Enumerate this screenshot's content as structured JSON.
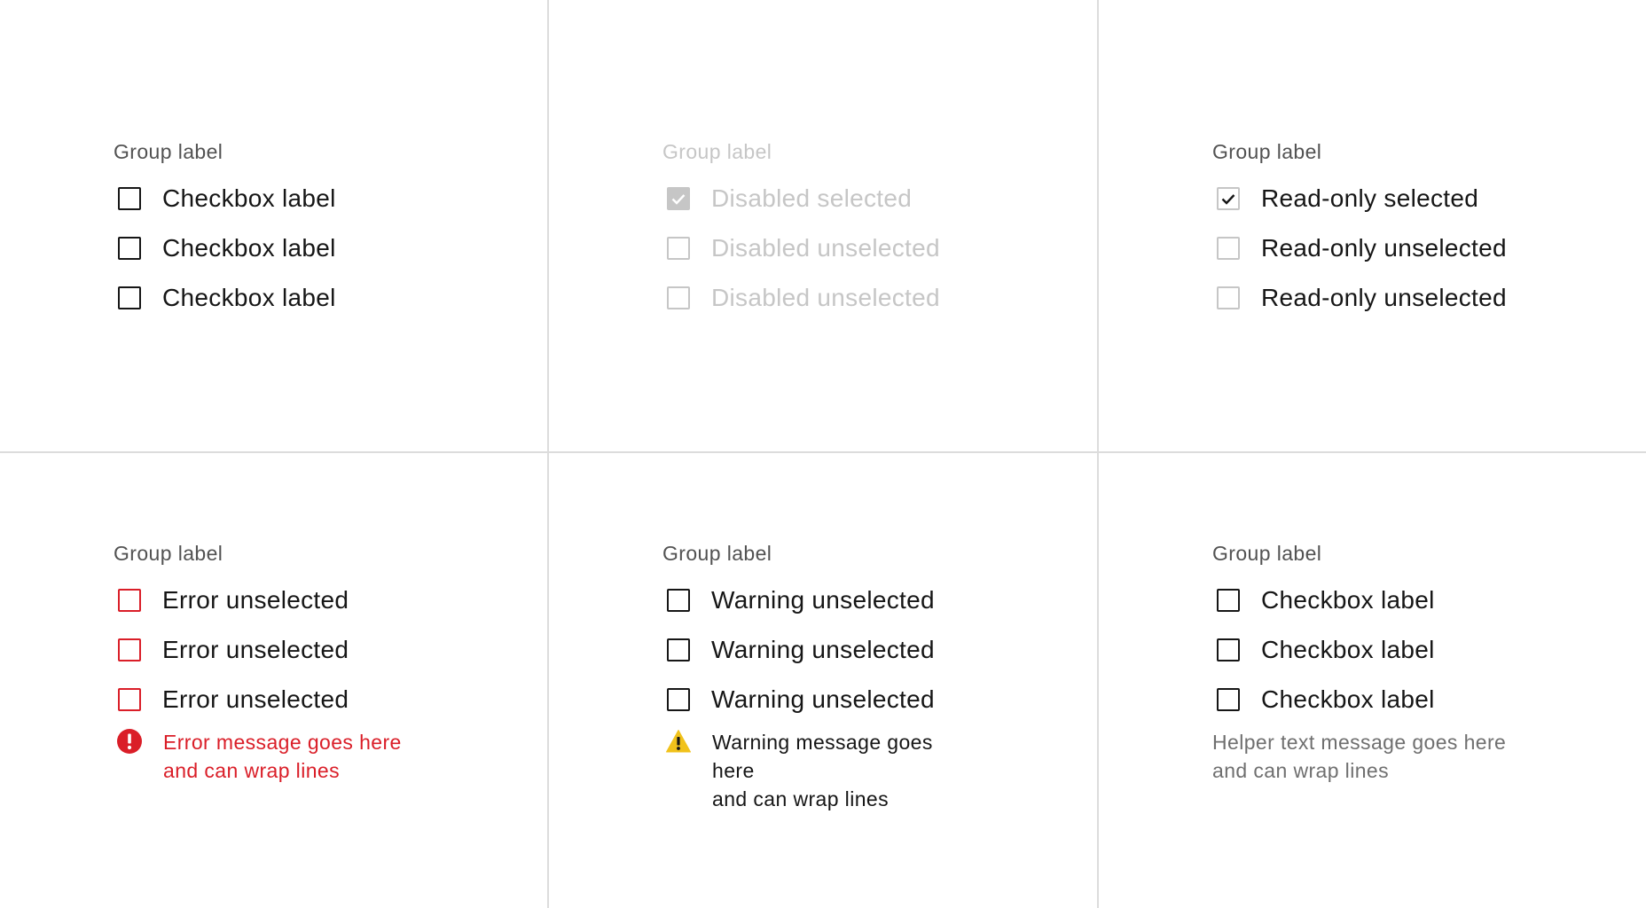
{
  "colors": {
    "text": "#161616",
    "label": "#525252",
    "disabled": "#c6c6c6",
    "error": "#da1e28",
    "warning": "#f1c21b",
    "helper": "#6f6f6f",
    "divider": "#dcdcdc"
  },
  "groups": [
    {
      "state": "default",
      "label": "Group label",
      "options": [
        {
          "label": "Checkbox label",
          "checked": false
        },
        {
          "label": "Checkbox label",
          "checked": false
        },
        {
          "label": "Checkbox label",
          "checked": false
        }
      ]
    },
    {
      "state": "disabled",
      "label": "Group label",
      "options": [
        {
          "label": "Disabled selected",
          "checked": true
        },
        {
          "label": "Disabled unselected",
          "checked": false
        },
        {
          "label": "Disabled unselected",
          "checked": false
        }
      ]
    },
    {
      "state": "read-only",
      "label": "Group label",
      "options": [
        {
          "label": "Read-only selected",
          "checked": true
        },
        {
          "label": "Read-only unselected",
          "checked": false
        },
        {
          "label": "Read-only unselected",
          "checked": false
        }
      ]
    },
    {
      "state": "error",
      "label": "Group label",
      "options": [
        {
          "label": "Error unselected",
          "checked": false
        },
        {
          "label": "Error unselected",
          "checked": false
        },
        {
          "label": "Error unselected",
          "checked": false
        }
      ],
      "message": {
        "icon": "error-filled-icon",
        "line1": "Error message goes here",
        "line2": "and can wrap lines"
      }
    },
    {
      "state": "warning",
      "label": "Group label",
      "options": [
        {
          "label": "Warning unselected",
          "checked": false
        },
        {
          "label": "Warning unselected",
          "checked": false
        },
        {
          "label": "Warning unselected",
          "checked": false
        }
      ],
      "message": {
        "icon": "warning-alt-filled-icon",
        "line1": "Warning message goes here",
        "line2": "and can wrap lines"
      }
    },
    {
      "state": "helper",
      "label": "Group label",
      "options": [
        {
          "label": "Checkbox label",
          "checked": false
        },
        {
          "label": "Checkbox label",
          "checked": false
        },
        {
          "label": "Checkbox label",
          "checked": false
        }
      ],
      "message": {
        "line1": "Helper text message goes here",
        "line2": "and can wrap lines"
      }
    }
  ]
}
